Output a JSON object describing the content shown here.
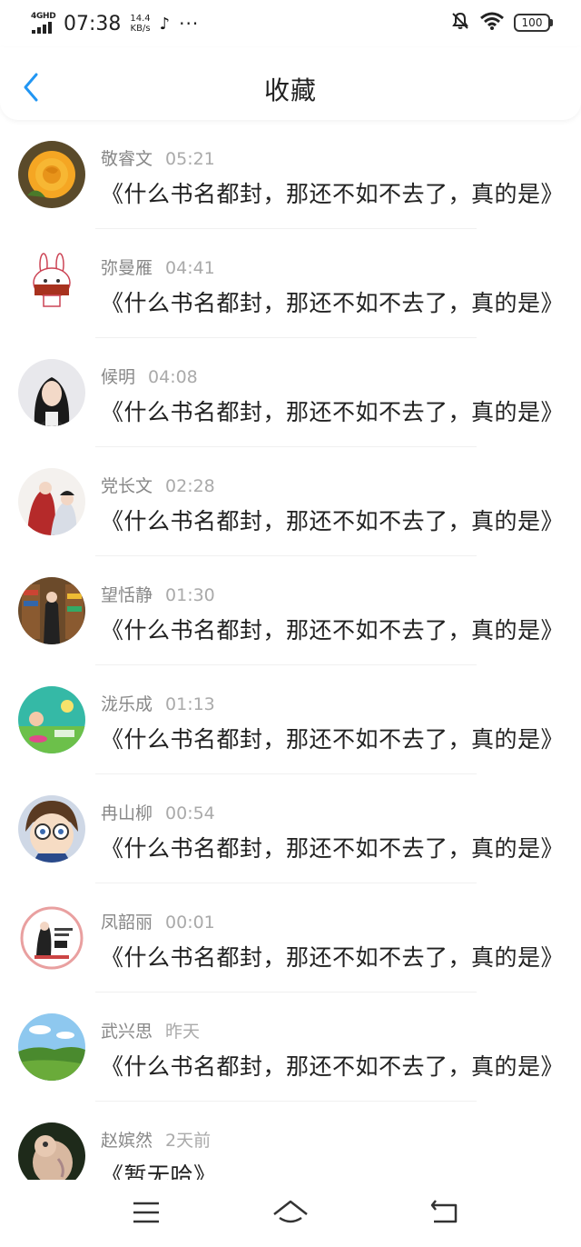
{
  "status_bar": {
    "network": "4GHD",
    "time": "07:38",
    "speed_value": "14.4",
    "speed_unit": "KB/s",
    "tiktok_glyph": "♪",
    "more_glyph": "···",
    "battery": "100"
  },
  "header": {
    "title": "收藏"
  },
  "items": [
    {
      "name": "敬睿文",
      "time": "05:21",
      "message": "《什么书名都封，那还不如不去了，真的是》",
      "avatar": "rose-avatar"
    },
    {
      "name": "弥曼雁",
      "time": "04:41",
      "message": "《什么书名都封，那还不如不去了，真的是》",
      "avatar": "bunny-avatar"
    },
    {
      "name": "候明",
      "time": "04:08",
      "message": "《什么书名都封，那还不如不去了，真的是》",
      "avatar": "girl-photo-avatar"
    },
    {
      "name": "党长文",
      "time": "02:28",
      "message": "《什么书名都封，那还不如不去了，真的是》",
      "avatar": "anime-couple-avatar"
    },
    {
      "name": "望恬静",
      "time": "01:30",
      "message": "《什么书名都封，那还不如不去了，真的是》",
      "avatar": "bookstore-avatar"
    },
    {
      "name": "泷乐成",
      "time": "01:13",
      "message": "《什么书名都封，那还不如不去了，真的是》",
      "avatar": "cartoon-avatar"
    },
    {
      "name": "冉山柳",
      "time": "00:54",
      "message": "《什么书名都封，那还不如不去了，真的是》",
      "avatar": "detective-avatar"
    },
    {
      "name": "凤韶丽",
      "time": "00:01",
      "message": "《什么书名都封，那还不如不去了，真的是》",
      "avatar": "badge-avatar"
    },
    {
      "name": "武兴思",
      "time": "昨天",
      "message": "《什么书名都封，那还不如不去了，真的是》",
      "avatar": "landscape-avatar"
    },
    {
      "name": "赵嫔然",
      "time": "2天前",
      "message": "《暂无哈》",
      "avatar": "cat-avatar"
    }
  ],
  "colors": {
    "accent": "#2196F3",
    "name_text": "#888888",
    "time_text": "#aaaaaa",
    "message_text": "#222222"
  }
}
